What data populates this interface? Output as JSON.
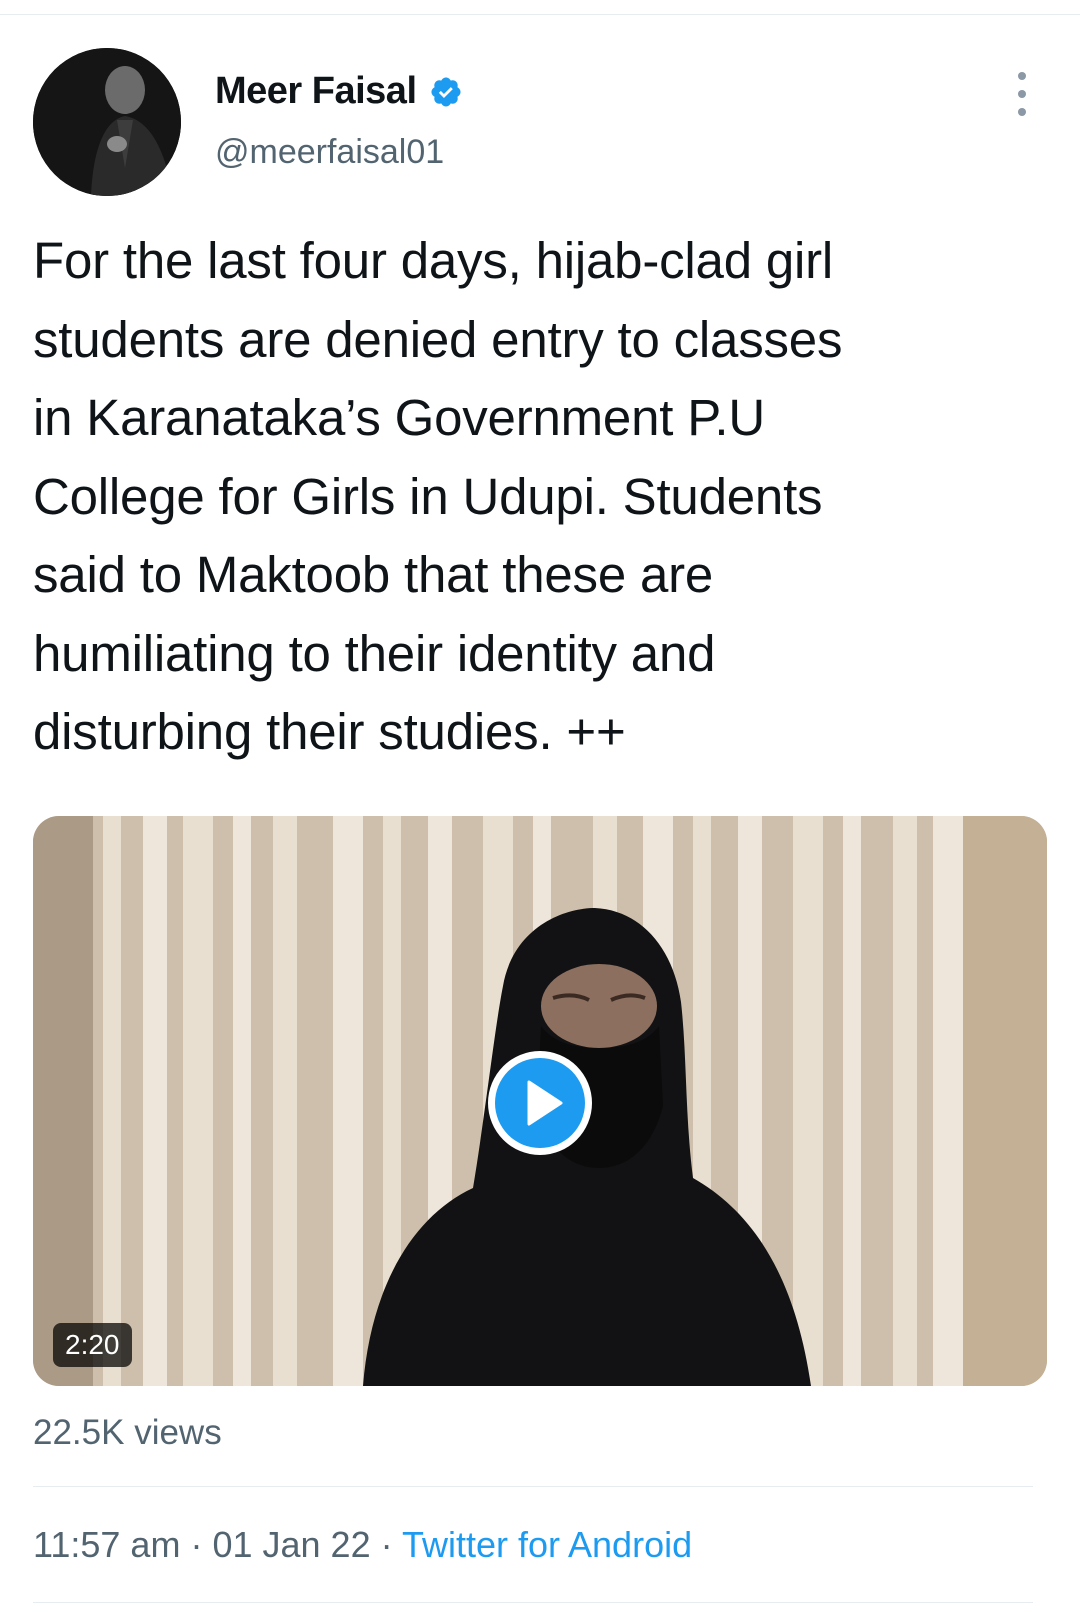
{
  "tweet": {
    "author": {
      "display_name": "Meer Faisal",
      "handle": "@meerfaisal01",
      "verified": true
    },
    "text": "For the last four days, hijab-clad girl\nstudents are denied entry to classes\nin Karanataka’s Government P.U\nCollege for Girls in Udupi. Students\nsaid to Maktoob that these are\nhumiliating to their identity and\ndisturbing their studies. ++",
    "media": {
      "duration": "2:20",
      "play_icon": "play-icon"
    },
    "views": "22.5K views",
    "time": "11:57 am",
    "separator": "·",
    "date": "01 Jan 22",
    "source": "Twitter for Android"
  },
  "colors": {
    "accent": "#1d9bf0",
    "secondary_text": "#536471",
    "primary_text": "#0f1419",
    "divider": "#e6ecf0"
  },
  "icons": [
    "verified-badge-icon",
    "more-options-icon",
    "play-icon"
  ]
}
